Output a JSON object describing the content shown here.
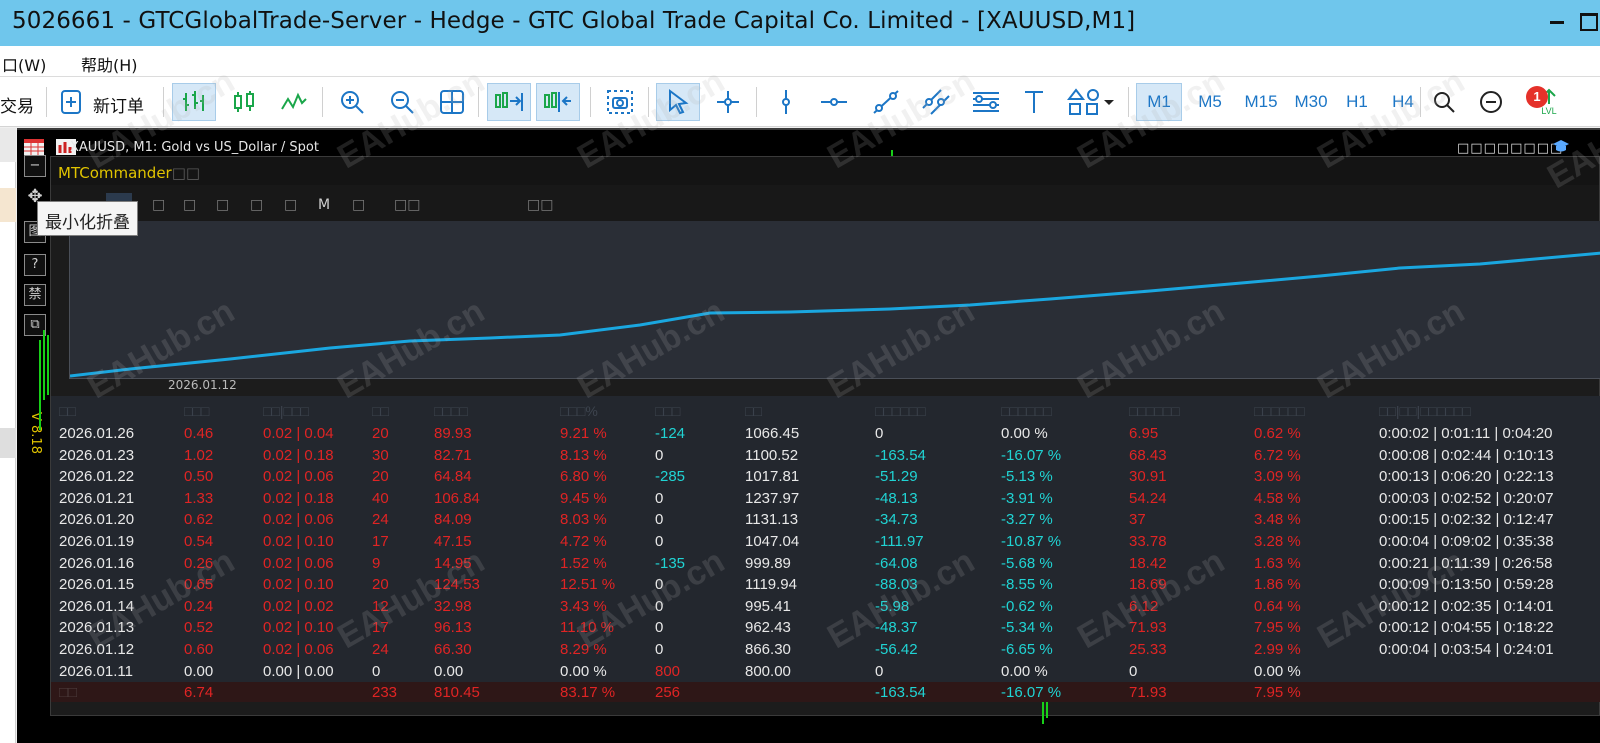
{
  "window": {
    "title": "5026661 - GTCGlobalTrade-Server - Hedge - GTC Global Trade Capital Co. Limited - [XAUUSD,M1]"
  },
  "menu": {
    "items": [
      "口(W)",
      "帮助(H)"
    ]
  },
  "toolbar": {
    "trade_label": "交易",
    "new_order_label": "新订单",
    "timeframes": [
      "M1",
      "M5",
      "M15",
      "M30",
      "H1",
      "H4"
    ],
    "selected_timeframe": "M1",
    "notification_count": "1",
    "lvl_label": "LVL"
  },
  "chart": {
    "title": "XAUUSD, M1:  Gold vs US_Dollar / Spot",
    "top_right_glyphs": "□□□□□□□□",
    "panel_title": "MTCommander",
    "panel_title_glyphs": "□□",
    "panel_tabs": [
      "□",
      "□",
      "□",
      "□",
      "□",
      "M",
      "□",
      "□□",
      "□□"
    ],
    "tooltip": "最小化折叠",
    "side_buttons": [
      "−",
      "✥",
      "图",
      "?",
      "禁",
      "⧉"
    ],
    "version_label": "V 8.18",
    "graph_date_label": "2026.01.12",
    "line_color": "#1aa7e0"
  },
  "table": {
    "headers": [
      "□□",
      "□□□",
      "□□|□□□",
      "□□",
      "□□□□",
      "□□□%",
      "□□□",
      "□□",
      "□□□□□□",
      "□□□□□□",
      "□□□□□□",
      "□□□□□□",
      "□□|□□|□□□□□□"
    ],
    "rows": [
      [
        "2026.01.26",
        "0.46",
        "0.02 | 0.04",
        "20",
        "89.93",
        "9.21 %",
        "-124",
        "1066.45",
        "0",
        "0.00 %",
        "6.95",
        "0.62 %",
        "0:00:02 | 0:01:11 | 0:04:20"
      ],
      [
        "2026.01.23",
        "1.02",
        "0.02 | 0.18",
        "30",
        "82.71",
        "8.13 %",
        "0",
        "1100.52",
        "-163.54",
        "-16.07 %",
        "68.43",
        "6.72 %",
        "0:00:08 | 0:02:44 | 0:10:13"
      ],
      [
        "2026.01.22",
        "0.50",
        "0.02 | 0.06",
        "20",
        "64.84",
        "6.80 %",
        "-285",
        "1017.81",
        "-51.29",
        "-5.13 %",
        "30.91",
        "3.09 %",
        "0:00:13 | 0:06:20 | 0:22:13"
      ],
      [
        "2026.01.21",
        "1.33",
        "0.02 | 0.18",
        "40",
        "106.84",
        "9.45 %",
        "0",
        "1237.97",
        "-48.13",
        "-3.91 %",
        "54.24",
        "4.58 %",
        "0:00:03 | 0:02:52 | 0:20:07"
      ],
      [
        "2026.01.20",
        "0.62",
        "0.02 | 0.06",
        "24",
        "84.09",
        "8.03 %",
        "0",
        "1131.13",
        "-34.73",
        "-3.27 %",
        "37",
        "3.48 %",
        "0:00:15 | 0:02:32 | 0:12:47"
      ],
      [
        "2026.01.19",
        "0.54",
        "0.02 | 0.10",
        "17",
        "47.15",
        "4.72 %",
        "0",
        "1047.04",
        "-111.97",
        "-10.87 %",
        "33.78",
        "3.28 %",
        "0:00:04 | 0:09:02 | 0:35:38"
      ],
      [
        "2026.01.16",
        "0.26",
        "0.02 | 0.06",
        "9",
        "14.95",
        "1.52 %",
        "-135",
        "999.89",
        "-64.08",
        "-5.68 %",
        "18.42",
        "1.63 %",
        "0:00:21 | 0:11:39 | 0:26:58"
      ],
      [
        "2026.01.15",
        "0.65",
        "0.02 | 0.10",
        "20",
        "124.53",
        "12.51 %",
        "0",
        "1119.94",
        "-88.03",
        "-8.55 %",
        "18.69",
        "1.86 %",
        "0:00:09 | 0:13:50 | 0:59:28"
      ],
      [
        "2026.01.14",
        "0.24",
        "0.02 | 0.02",
        "12",
        "32.98",
        "3.43 %",
        "0",
        "995.41",
        "-5.98",
        "-0.62 %",
        "6.12",
        "0.64 %",
        "0:00:12 | 0:02:35 | 0:14:01"
      ],
      [
        "2026.01.13",
        "0.52",
        "0.02 | 0.10",
        "17",
        "96.13",
        "11.10 %",
        "0",
        "962.43",
        "-48.37",
        "-5.34 %",
        "71.93",
        "7.95 %",
        "0:00:12 | 0:04:55 | 0:18:22"
      ],
      [
        "2026.01.12",
        "0.60",
        "0.02 | 0.06",
        "24",
        "66.30",
        "8.29 %",
        "0",
        "866.30",
        "-56.42",
        "-6.65 %",
        "25.33",
        "2.99 %",
        "0:00:04 | 0:03:54 | 0:24:01"
      ],
      [
        "2026.01.11",
        "0.00",
        "0.00 | 0.00",
        "0",
        "0.00",
        "0.00 %",
        "800",
        "800.00",
        "0",
        "0.00 %",
        "0",
        "0.00 %",
        ""
      ]
    ],
    "total": [
      "□□",
      "6.74",
      "",
      "233",
      "810.45",
      "83.17 %",
      "256",
      "",
      "-163.54",
      "-16.07 %",
      "71.93",
      "7.95 %",
      ""
    ]
  },
  "watermark": "EAHub.cn"
}
